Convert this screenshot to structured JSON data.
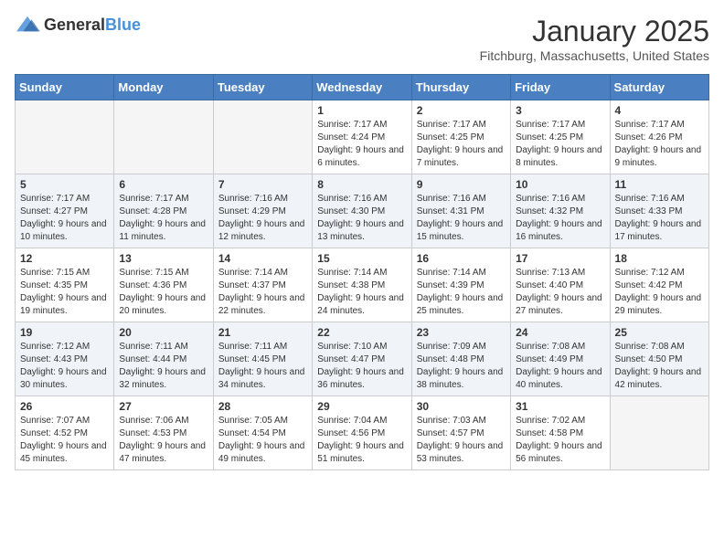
{
  "header": {
    "logo_general": "General",
    "logo_blue": "Blue",
    "title": "January 2025",
    "location": "Fitchburg, Massachusetts, United States"
  },
  "weekdays": [
    "Sunday",
    "Monday",
    "Tuesday",
    "Wednesday",
    "Thursday",
    "Friday",
    "Saturday"
  ],
  "weeks": [
    [
      {
        "day": "",
        "info": ""
      },
      {
        "day": "",
        "info": ""
      },
      {
        "day": "",
        "info": ""
      },
      {
        "day": "1",
        "info": "Sunrise: 7:17 AM\nSunset: 4:24 PM\nDaylight: 9 hours and 6 minutes."
      },
      {
        "day": "2",
        "info": "Sunrise: 7:17 AM\nSunset: 4:25 PM\nDaylight: 9 hours and 7 minutes."
      },
      {
        "day": "3",
        "info": "Sunrise: 7:17 AM\nSunset: 4:25 PM\nDaylight: 9 hours and 8 minutes."
      },
      {
        "day": "4",
        "info": "Sunrise: 7:17 AM\nSunset: 4:26 PM\nDaylight: 9 hours and 9 minutes."
      }
    ],
    [
      {
        "day": "5",
        "info": "Sunrise: 7:17 AM\nSunset: 4:27 PM\nDaylight: 9 hours and 10 minutes."
      },
      {
        "day": "6",
        "info": "Sunrise: 7:17 AM\nSunset: 4:28 PM\nDaylight: 9 hours and 11 minutes."
      },
      {
        "day": "7",
        "info": "Sunrise: 7:16 AM\nSunset: 4:29 PM\nDaylight: 9 hours and 12 minutes."
      },
      {
        "day": "8",
        "info": "Sunrise: 7:16 AM\nSunset: 4:30 PM\nDaylight: 9 hours and 13 minutes."
      },
      {
        "day": "9",
        "info": "Sunrise: 7:16 AM\nSunset: 4:31 PM\nDaylight: 9 hours and 15 minutes."
      },
      {
        "day": "10",
        "info": "Sunrise: 7:16 AM\nSunset: 4:32 PM\nDaylight: 9 hours and 16 minutes."
      },
      {
        "day": "11",
        "info": "Sunrise: 7:16 AM\nSunset: 4:33 PM\nDaylight: 9 hours and 17 minutes."
      }
    ],
    [
      {
        "day": "12",
        "info": "Sunrise: 7:15 AM\nSunset: 4:35 PM\nDaylight: 9 hours and 19 minutes."
      },
      {
        "day": "13",
        "info": "Sunrise: 7:15 AM\nSunset: 4:36 PM\nDaylight: 9 hours and 20 minutes."
      },
      {
        "day": "14",
        "info": "Sunrise: 7:14 AM\nSunset: 4:37 PM\nDaylight: 9 hours and 22 minutes."
      },
      {
        "day": "15",
        "info": "Sunrise: 7:14 AM\nSunset: 4:38 PM\nDaylight: 9 hours and 24 minutes."
      },
      {
        "day": "16",
        "info": "Sunrise: 7:14 AM\nSunset: 4:39 PM\nDaylight: 9 hours and 25 minutes."
      },
      {
        "day": "17",
        "info": "Sunrise: 7:13 AM\nSunset: 4:40 PM\nDaylight: 9 hours and 27 minutes."
      },
      {
        "day": "18",
        "info": "Sunrise: 7:12 AM\nSunset: 4:42 PM\nDaylight: 9 hours and 29 minutes."
      }
    ],
    [
      {
        "day": "19",
        "info": "Sunrise: 7:12 AM\nSunset: 4:43 PM\nDaylight: 9 hours and 30 minutes."
      },
      {
        "day": "20",
        "info": "Sunrise: 7:11 AM\nSunset: 4:44 PM\nDaylight: 9 hours and 32 minutes."
      },
      {
        "day": "21",
        "info": "Sunrise: 7:11 AM\nSunset: 4:45 PM\nDaylight: 9 hours and 34 minutes."
      },
      {
        "day": "22",
        "info": "Sunrise: 7:10 AM\nSunset: 4:47 PM\nDaylight: 9 hours and 36 minutes."
      },
      {
        "day": "23",
        "info": "Sunrise: 7:09 AM\nSunset: 4:48 PM\nDaylight: 9 hours and 38 minutes."
      },
      {
        "day": "24",
        "info": "Sunrise: 7:08 AM\nSunset: 4:49 PM\nDaylight: 9 hours and 40 minutes."
      },
      {
        "day": "25",
        "info": "Sunrise: 7:08 AM\nSunset: 4:50 PM\nDaylight: 9 hours and 42 minutes."
      }
    ],
    [
      {
        "day": "26",
        "info": "Sunrise: 7:07 AM\nSunset: 4:52 PM\nDaylight: 9 hours and 45 minutes."
      },
      {
        "day": "27",
        "info": "Sunrise: 7:06 AM\nSunset: 4:53 PM\nDaylight: 9 hours and 47 minutes."
      },
      {
        "day": "28",
        "info": "Sunrise: 7:05 AM\nSunset: 4:54 PM\nDaylight: 9 hours and 49 minutes."
      },
      {
        "day": "29",
        "info": "Sunrise: 7:04 AM\nSunset: 4:56 PM\nDaylight: 9 hours and 51 minutes."
      },
      {
        "day": "30",
        "info": "Sunrise: 7:03 AM\nSunset: 4:57 PM\nDaylight: 9 hours and 53 minutes."
      },
      {
        "day": "31",
        "info": "Sunrise: 7:02 AM\nSunset: 4:58 PM\nDaylight: 9 hours and 56 minutes."
      },
      {
        "day": "",
        "info": ""
      }
    ]
  ]
}
